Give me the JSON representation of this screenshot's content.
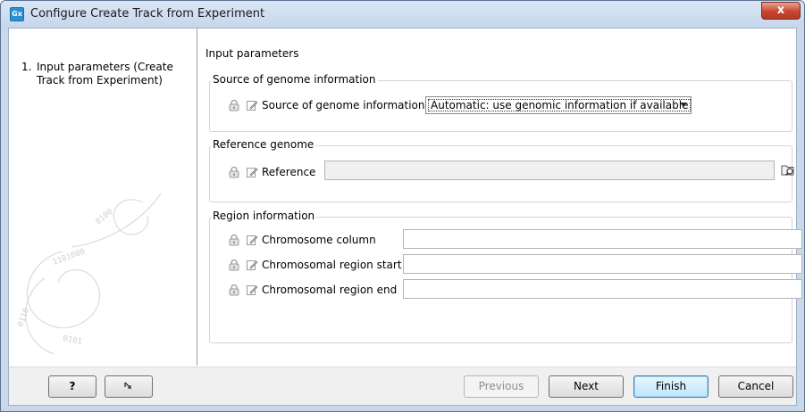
{
  "window": {
    "app_icon": "Gx",
    "title": "Configure Create Track from Experiment",
    "close_label": "x"
  },
  "steps": [
    {
      "number": "1.",
      "label": "Input parameters (Create Track from Experiment)"
    }
  ],
  "panel": {
    "title": "Input parameters"
  },
  "source_group": {
    "title": "Source of genome information",
    "field_label": "Source of genome information",
    "selected": "Automatic: use genomic information if available"
  },
  "reference_group": {
    "title": "Reference genome",
    "field_label": "Reference",
    "value": ""
  },
  "region_group": {
    "title": "Region information",
    "fields": [
      {
        "label": "Chromosome column",
        "value": ""
      },
      {
        "label": "Chromosomal region start",
        "value": ""
      },
      {
        "label": "Chromosomal region end",
        "value": ""
      }
    ]
  },
  "buttons": {
    "help": "?",
    "reset_icon": "reset-arrow-icon",
    "previous": "Previous",
    "next": "Next",
    "finish": "Finish",
    "cancel": "Cancel"
  },
  "colors": {
    "title_bar": "#c5d6ec",
    "close_button": "#c8452f",
    "default_button": "#bee6fd"
  }
}
